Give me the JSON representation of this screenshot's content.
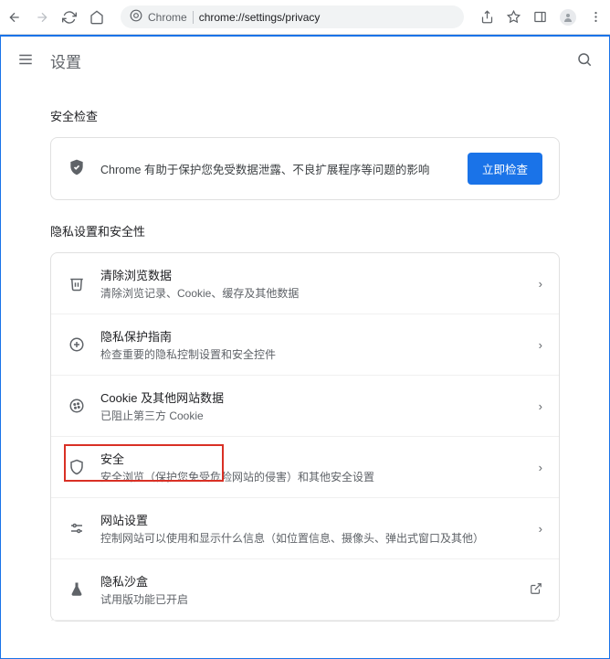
{
  "toolbar": {
    "chrome_label": "Chrome",
    "url": "chrome://settings/privacy"
  },
  "header": {
    "title": "设置"
  },
  "sections": {
    "safety_check_title": "安全检查",
    "privacy_title": "隐私设置和安全性"
  },
  "safety_check": {
    "desc": "Chrome 有助于保护您免受数据泄露、不良扩展程序等问题的影响",
    "button": "立即检查"
  },
  "privacy_items": [
    {
      "title": "清除浏览数据",
      "sub": "清除浏览记录、Cookie、缓存及其他数据"
    },
    {
      "title": "隐私保护指南",
      "sub": "检查重要的隐私控制设置和安全控件"
    },
    {
      "title": "Cookie 及其他网站数据",
      "sub": "已阻止第三方 Cookie"
    },
    {
      "title": "安全",
      "sub": "安全浏览（保护您免受危险网站的侵害）和其他安全设置"
    },
    {
      "title": "网站设置",
      "sub": "控制网站可以使用和显示什么信息（如位置信息、摄像头、弹出式窗口及其他）"
    },
    {
      "title": "隐私沙盒",
      "sub": "试用版功能已开启"
    }
  ]
}
